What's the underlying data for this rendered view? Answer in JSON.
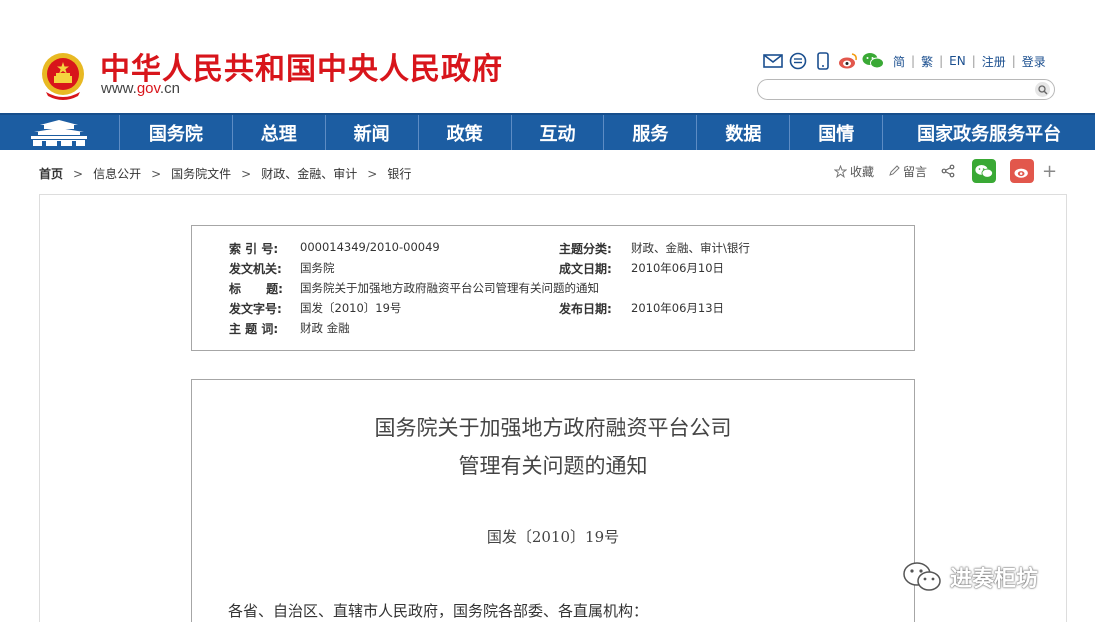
{
  "header": {
    "site_title": "中华人民共和国中央人民政府",
    "site_url_prefix": "www.",
    "site_url_gov": "gov",
    "site_url_suffix": ".cn",
    "tool_icons": [
      "mail-icon",
      "chat-bubble-icon",
      "mobile-phone-icon",
      "weibo-icon",
      "wechat-icon"
    ],
    "lang_links": [
      "简",
      "繁",
      "EN",
      "注册",
      "登录"
    ],
    "search": {
      "value": "",
      "placeholder": ""
    }
  },
  "nav": {
    "items": [
      "国务院",
      "总理",
      "新闻",
      "政策",
      "互动",
      "服务",
      "数据",
      "国情",
      "国家政务服务平台"
    ],
    "color": "#1c5da2"
  },
  "breadcrumb": [
    "首页",
    "信息公开",
    "国务院文件",
    "财政、金融、审计",
    "银行"
  ],
  "actions": {
    "favorite": "收藏",
    "comment": "留言"
  },
  "meta": {
    "index_label": "索 引 号:",
    "index_value": "000014349/2010-00049",
    "topic_label": "主题分类:",
    "topic_value": "财政、金融、审计\\银行",
    "issuer_label": "发文机关:",
    "issuer_value": "国务院",
    "written_label": "成文日期:",
    "written_value": "2010年06月10日",
    "title_label": "标      题:",
    "title_value": "国务院关于加强地方政府融资平台公司管理有关问题的通知",
    "docno_label": "发文字号:",
    "docno_value": "国发〔2010〕19号",
    "published_label": "发布日期:",
    "published_value": "2010年06月13日",
    "keywords_label": "主 题 词:",
    "keywords_value": "财政 金融"
  },
  "document": {
    "title_line1": "国务院关于加强地方政府融资平台公司",
    "title_line2": "管理有关问题的通知",
    "number": "国发〔2010〕19号",
    "salutation": "各省、自治区、直辖市人民政府，国务院各部委、各直属机构："
  },
  "watermark": "进奏柜坊"
}
